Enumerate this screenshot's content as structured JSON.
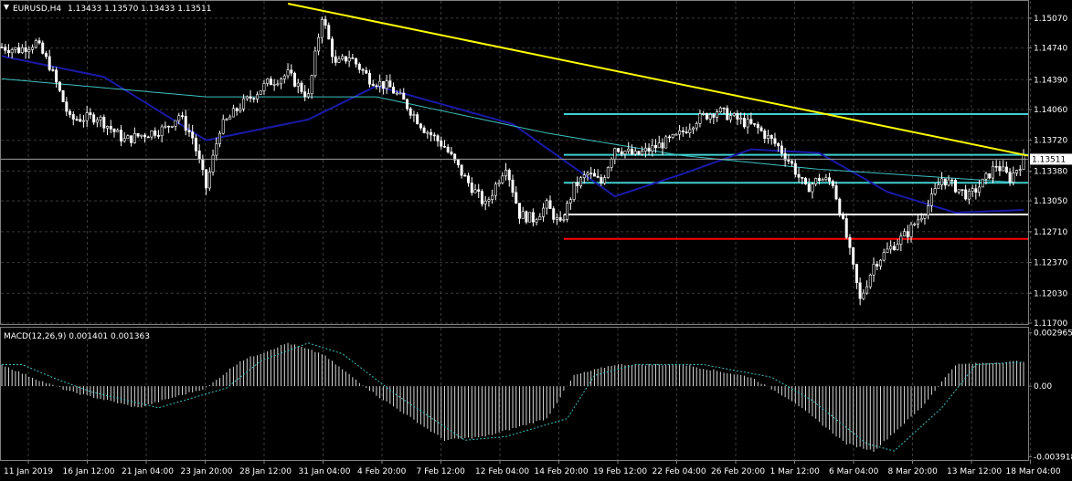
{
  "header": {
    "symbol": "EURUSD,H4",
    "ohlc": "1.13433 1.13570 1.13433 1.13511"
  },
  "macd": {
    "label": "MACD(12,26,9) 0.001401 0.001363",
    "ticks": [
      "0.002965",
      "0.00",
      "-0.003918"
    ]
  },
  "price_axis": {
    "ticks": [
      "1.15070",
      "1.14740",
      "1.14390",
      "1.14060",
      "1.13720",
      "1.13380",
      "1.13050",
      "1.12710",
      "1.12370",
      "1.12030",
      "1.11700"
    ],
    "current_price": "1.13511"
  },
  "time_axis": {
    "labels": [
      "11 Jan 2019",
      "16 Jan 12:00",
      "21 Jan 04:00",
      "23 Jan 20:00",
      "28 Jan 12:00",
      "31 Jan 04:00",
      "4 Feb 20:00",
      "7 Feb 12:00",
      "12 Feb 04:00",
      "14 Feb 20:00",
      "19 Feb 12:00",
      "22 Feb 04:00",
      "26 Feb 20:00",
      "1 Mar 12:00",
      "6 Mar 04:00",
      "8 Mar 20:00",
      "13 Mar 12:00",
      "18 Mar 04:00"
    ]
  },
  "colors": {
    "background": "#000000",
    "grid": "#3a3a3a",
    "candle_up": "#ffffff",
    "candle_down": "#ffffff",
    "trendline": "#ffff00",
    "ma_slow": "#1a1aa8",
    "ma_fast": "#40c0c0",
    "level_cyan": "#40d0d0",
    "level_white": "#ffffff",
    "level_red": "#ff0000",
    "macd_hist": "#d8d8d8",
    "macd_signal": "#40c0c0"
  },
  "chart_data": {
    "type": "candlestick",
    "symbol": "EURUSD",
    "timeframe": "H4",
    "ylim": [
      1.117,
      1.1525
    ],
    "price_path": [
      [
        0,
        1.1475
      ],
      [
        5,
        1.1472
      ],
      [
        10,
        1.148
      ],
      [
        14,
        1.1455
      ],
      [
        20,
        1.1395
      ],
      [
        28,
        1.1398
      ],
      [
        36,
        1.1372
      ],
      [
        42,
        1.1379
      ],
      [
        48,
        1.1385
      ],
      [
        52,
        1.14
      ],
      [
        56,
        1.1375
      ],
      [
        60,
        1.132
      ],
      [
        64,
        1.1385
      ],
      [
        70,
        1.141
      ],
      [
        78,
        1.1435
      ],
      [
        84,
        1.1445
      ],
      [
        90,
        1.142
      ],
      [
        94,
        1.151
      ],
      [
        98,
        1.1455
      ],
      [
        102,
        1.1465
      ],
      [
        108,
        1.144
      ],
      [
        114,
        1.143
      ],
      [
        118,
        1.1415
      ],
      [
        124,
        1.1385
      ],
      [
        130,
        1.1365
      ],
      [
        136,
        1.133
      ],
      [
        142,
        1.13
      ],
      [
        148,
        1.1345
      ],
      [
        152,
        1.129
      ],
      [
        156,
        1.1285
      ],
      [
        160,
        1.13
      ],
      [
        164,
        1.1278
      ],
      [
        168,
        1.132
      ],
      [
        172,
        1.1335
      ],
      [
        176,
        1.1325
      ],
      [
        180,
        1.1365
      ],
      [
        186,
        1.1355
      ],
      [
        192,
        1.1365
      ],
      [
        198,
        1.1375
      ],
      [
        204,
        1.1395
      ],
      [
        210,
        1.1405
      ],
      [
        216,
        1.1395
      ],
      [
        222,
        1.1385
      ],
      [
        228,
        1.1365
      ],
      [
        232,
        1.1345
      ],
      [
        236,
        1.1318
      ],
      [
        240,
        1.133
      ],
      [
        244,
        1.1325
      ],
      [
        248,
        1.1265
      ],
      [
        252,
        1.1195
      ],
      [
        256,
        1.1235
      ],
      [
        260,
        1.125
      ],
      [
        266,
        1.127
      ],
      [
        272,
        1.13
      ],
      [
        276,
        1.133
      ],
      [
        280,
        1.132
      ],
      [
        284,
        1.131
      ],
      [
        288,
        1.1325
      ],
      [
        292,
        1.1345
      ],
      [
        296,
        1.133
      ],
      [
        300,
        1.1351
      ]
    ],
    "moving_averages": [
      {
        "name": "slow",
        "points": [
          [
            0,
            1.1465
          ],
          [
            30,
            1.1442
          ],
          [
            60,
            1.1372
          ],
          [
            90,
            1.1395
          ],
          [
            110,
            1.1432
          ],
          [
            150,
            1.139
          ],
          [
            180,
            1.131
          ],
          [
            200,
            1.1335
          ],
          [
            220,
            1.1362
          ],
          [
            240,
            1.1358
          ],
          [
            260,
            1.1315
          ],
          [
            280,
            1.1292
          ],
          [
            300,
            1.1295
          ]
        ]
      },
      {
        "name": "fast",
        "points": [
          [
            0,
            1.144
          ],
          [
            60,
            1.142
          ],
          [
            110,
            1.142
          ],
          [
            160,
            1.138
          ],
          [
            200,
            1.1355
          ],
          [
            240,
            1.134
          ],
          [
            280,
            1.133
          ],
          [
            300,
            1.1325
          ]
        ]
      }
    ],
    "trendline": {
      "from": [
        84,
        1.1523
      ],
      "to": [
        300,
        1.1355
      ]
    },
    "horizontal_levels": [
      {
        "color": "cyan",
        "price": 1.1401,
        "from": 165,
        "to": 300
      },
      {
        "color": "cyan",
        "price": 1.1356,
        "from": 165,
        "to": 300
      },
      {
        "color": "cyan",
        "price": 1.1325,
        "from": 165,
        "to": 300
      },
      {
        "color": "white",
        "price": 1.129,
        "from": 165,
        "to": 300
      },
      {
        "color": "red",
        "price": 1.1263,
        "from": 165,
        "to": 300
      }
    ],
    "macd": {
      "ylim": [
        -0.004,
        0.0031
      ],
      "hist_path": [
        [
          0,
          0.0012
        ],
        [
          10,
          0.0004
        ],
        [
          20,
          -0.0003
        ],
        [
          40,
          -0.0012
        ],
        [
          60,
          -0.0001
        ],
        [
          70,
          0.0014
        ],
        [
          84,
          0.0024
        ],
        [
          94,
          0.0018
        ],
        [
          110,
          -0.0005
        ],
        [
          130,
          -0.003
        ],
        [
          142,
          -0.0028
        ],
        [
          160,
          -0.0018
        ],
        [
          168,
          0.0006
        ],
        [
          180,
          0.0012
        ],
        [
          200,
          0.0012
        ],
        [
          220,
          0.0005
        ],
        [
          232,
          -0.0008
        ],
        [
          248,
          -0.0032
        ],
        [
          256,
          -0.0036
        ],
        [
          270,
          -0.0012
        ],
        [
          280,
          0.0012
        ],
        [
          300,
          0.0014
        ]
      ]
    }
  }
}
